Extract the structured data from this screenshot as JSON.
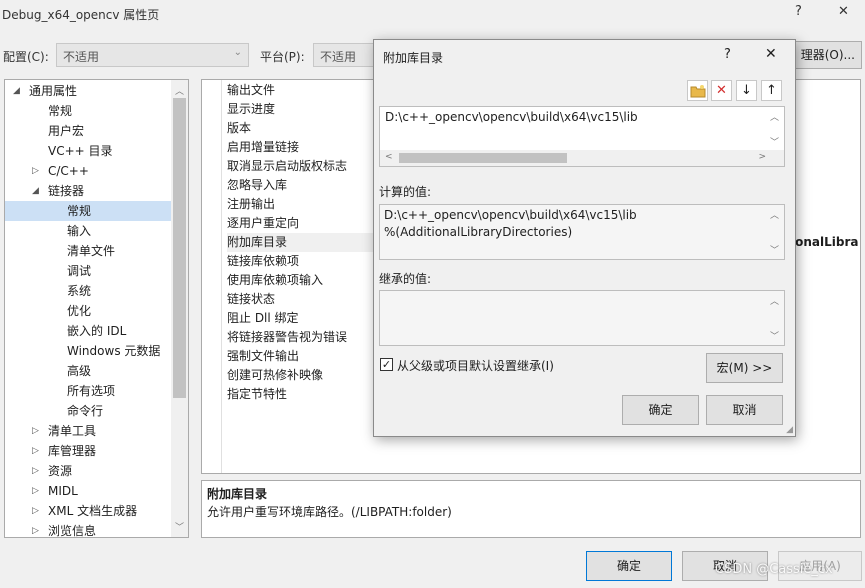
{
  "window": {
    "title": "Debug_x64_opencv 属性页",
    "help_glyph": "?",
    "close_glyph": "✕"
  },
  "toolbar": {
    "config_label": "配置(C):",
    "config_value": "不适用",
    "platform_label": "平台(P):",
    "platform_value": "不适用",
    "config_manager_fragment": "理器(O)..."
  },
  "tree": {
    "items": [
      {
        "label": "通用属性",
        "expander": "◢"
      },
      {
        "label": "常规"
      },
      {
        "label": "用户宏"
      },
      {
        "label": "VC++ 目录"
      },
      {
        "label": "C/C++",
        "expander": "▷"
      },
      {
        "label": "链接器",
        "expander": "◢"
      },
      {
        "label": "常规",
        "selected": true
      },
      {
        "label": "输入"
      },
      {
        "label": "清单文件"
      },
      {
        "label": "调试"
      },
      {
        "label": "系统"
      },
      {
        "label": "优化"
      },
      {
        "label": "嵌入的 IDL"
      },
      {
        "label": "Windows 元数据"
      },
      {
        "label": "高级"
      },
      {
        "label": "所有选项"
      },
      {
        "label": "命令行"
      },
      {
        "label": "清单工具",
        "expander": "▷"
      },
      {
        "label": "库管理器",
        "expander": "▷"
      },
      {
        "label": "资源",
        "expander": "▷"
      },
      {
        "label": "MIDL",
        "expander": "▷"
      },
      {
        "label": "XML 文档生成器",
        "expander": "▷"
      },
      {
        "label": "浏览信息",
        "expander": "▷"
      }
    ]
  },
  "grid": {
    "properties": [
      "输出文件",
      "显示进度",
      "版本",
      "启用增量链接",
      "取消显示启动版权标志",
      "忽略导入库",
      "注册输出",
      "逐用户重定向",
      "附加库目录",
      "链接库依赖项",
      "使用库依赖项输入",
      "链接状态",
      "阻止 Dll 绑定",
      "将链接器警告视为错误",
      "强制文件输出",
      "创建可热修补映像",
      "指定节特性"
    ],
    "selected_value_fragment": "ionalLibra"
  },
  "description": {
    "title": "附加库目录",
    "text": "允许用户重写环境库路径。(/LIBPATH:folder)"
  },
  "footer": {
    "ok": "确定",
    "cancel": "取消",
    "apply": "应用(A)"
  },
  "watermark": "CSDN @Cassie_cx",
  "dialog": {
    "title": "附加库目录",
    "help_glyph": "?",
    "close_glyph": "✕",
    "input_value": "D:\\c++_opencv\\opencv\\build\\x64\\vc15\\lib",
    "computed_label": "计算的值:",
    "computed_lines": [
      "D:\\c++_opencv\\opencv\\build\\x64\\vc15\\lib",
      "%(AdditionalLibraryDirectories)"
    ],
    "inherited_label": "继承的值:",
    "inherit_checkbox_label": "从父级或项目默认设置继承(I)",
    "inherit_checked": true,
    "macros_button": "宏(M) >>",
    "ok": "确定",
    "cancel": "取消"
  },
  "colors": {
    "selection": "#cce0f5",
    "delete_red": "#d32f2f",
    "folder_yellow": "#e8b84a",
    "accent_blue": "#0078d7"
  }
}
